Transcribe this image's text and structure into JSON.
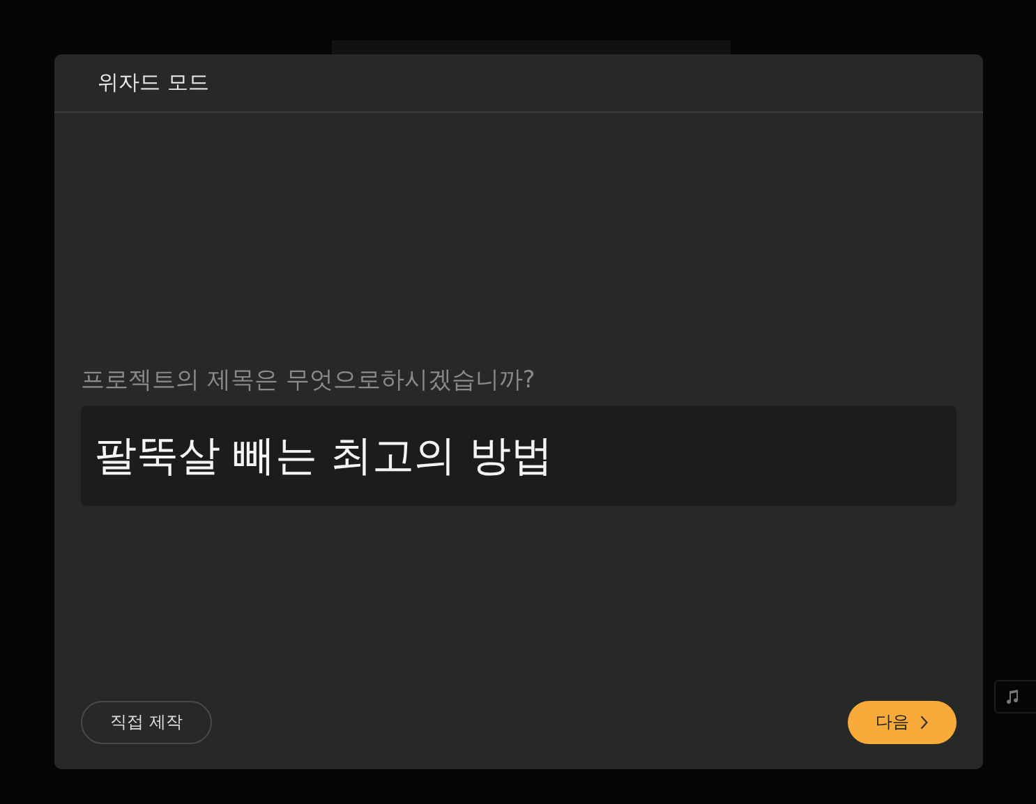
{
  "dialog": {
    "title": "위자드 모드",
    "question": "프로젝트의 제목은 무엇으로하시겠습니까?",
    "title_field": {
      "value": "팔뚝살 빼는 최고의 방법"
    },
    "buttons": [
      {
        "kind": "secondary",
        "label": "직접 제작"
      },
      {
        "kind": "primary",
        "label": "다음"
      }
    ]
  }
}
